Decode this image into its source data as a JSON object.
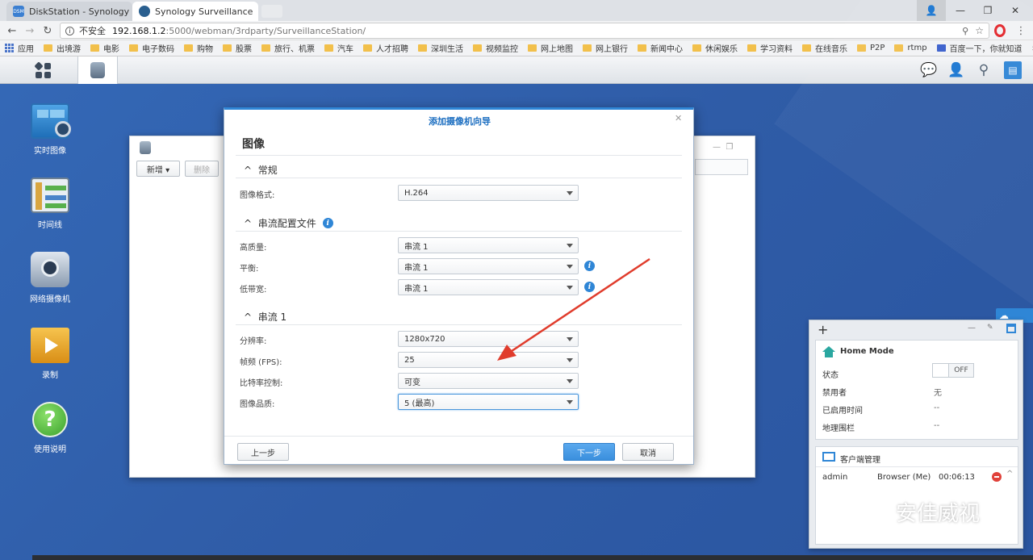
{
  "browser": {
    "tabs": [
      {
        "title": "DiskStation - Synology",
        "fav_color": "#3b7fd1",
        "fav_text": "DSM",
        "active": false
      },
      {
        "title": "Synology Surveillance",
        "fav_color": "#2a5f8f",
        "fav_text": "",
        "active": true
      }
    ],
    "window_controls": {
      "minimize": "—",
      "restore": "❐",
      "close": "✕",
      "user": "👤"
    },
    "address": {
      "insecure_label": "不安全",
      "url_host": "192.168.1.2",
      "url_rest": ":5000/webman/3rdparty/SurveillanceStation/"
    },
    "bookmarks": [
      "应用",
      "出境游",
      "电影",
      "电子数码",
      "购物",
      "股票",
      "旅行、机票",
      "汽车",
      "人才招聘",
      "深圳生活",
      "视频监控",
      "网上地图",
      "网上银行",
      "新闻中心",
      "休闲娱乐",
      "学习资料",
      "在线音乐",
      "P2P",
      "rtmp",
      "百度一下，你就知道"
    ],
    "bookmarks_more": "»"
  },
  "desktop": {
    "icons": [
      {
        "label": "实时图像",
        "icon": "live-view-icon"
      },
      {
        "label": "时间线",
        "icon": "timeline-icon"
      },
      {
        "label": "网络摄像机",
        "icon": "ip-camera-icon"
      },
      {
        "label": "录制",
        "icon": "recording-icon"
      },
      {
        "label": "使用说明",
        "icon": "help-icon"
      }
    ]
  },
  "back_window": {
    "add_button": "新增 ▾",
    "delete_button": "删除"
  },
  "dialog": {
    "title": "添加摄像机向导",
    "heading": "图像",
    "close": "✕",
    "sections": {
      "general": "常规",
      "stream_profile": "串流配置文件",
      "stream1": "串流 1"
    },
    "fields": {
      "image_format": {
        "label": "图像格式:",
        "value": "H.264"
      },
      "high_quality": {
        "label": "高质量:",
        "value": "串流 1"
      },
      "balanced": {
        "label": "平衡:",
        "value": "串流 1"
      },
      "low_bandwidth": {
        "label": "低带宽:",
        "value": "串流 1"
      },
      "resolution": {
        "label": "分辨率:",
        "value": "1280x720"
      },
      "fps": {
        "label": "帧频 (FPS):",
        "value": "25"
      },
      "bitrate": {
        "label": "比特率控制:",
        "value": "可变"
      },
      "quality": {
        "label": "图像品质:",
        "value": "5 (最高)"
      }
    },
    "buttons": {
      "prev": "上一步",
      "next": "下一步",
      "cancel": "取消"
    }
  },
  "panel": {
    "add": "+",
    "min": "—",
    "pin": "📌",
    "home_mode_title": "Home Mode",
    "status_label": "状态",
    "toggle_value": "OFF",
    "disabled_by_label": "禁用者",
    "disabled_by_value": "无",
    "enabled_time_label": "已启用时间",
    "enabled_time_value": "--",
    "geofence_label": "地理围栏",
    "geofence_value": "--",
    "client_title": "客户端管理",
    "client_user": "admin",
    "client_type": "Browser (Me)",
    "client_time": "00:06:13"
  },
  "watermark": "安佳威视",
  "colors": {
    "accent": "#2f86d6",
    "desktop": "#2f5da8",
    "arrow": "#e03c2c"
  }
}
